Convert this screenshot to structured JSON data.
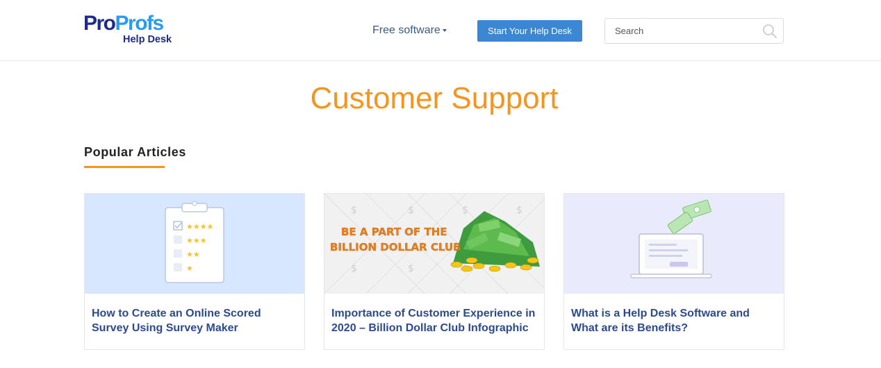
{
  "header": {
    "logo": {
      "brand_part1": "Pro",
      "brand_part2": "Profs",
      "subtitle": "Help Desk"
    },
    "nav": {
      "free_software_label": "Free software"
    },
    "cta_label": "Start Your Help Desk",
    "search": {
      "placeholder": "Search",
      "value": ""
    }
  },
  "main": {
    "page_title": "Customer Support",
    "section_title": "Popular Articles",
    "articles": [
      {
        "title": "How to Create an Online Scored Survey Using Survey Maker",
        "image": "scored-survey-clipboard-illustration"
      },
      {
        "title": "Importance of Customer Experience in 2020 – Billion Dollar Club Infographic",
        "image": "billion-dollar-club-money-pile",
        "image_text": "BE A PART OF THE BILLION DOLLAR CLUB"
      },
      {
        "title": "What is a Help Desk Software and What are its Benefits?",
        "image": "laptop-with-money-illustration"
      }
    ]
  },
  "colors": {
    "accent_orange": "#f7941d",
    "brand_blue": "#1d2a8f",
    "cta_blue": "#3b87d4",
    "link_blue": "#2c4a8f"
  }
}
